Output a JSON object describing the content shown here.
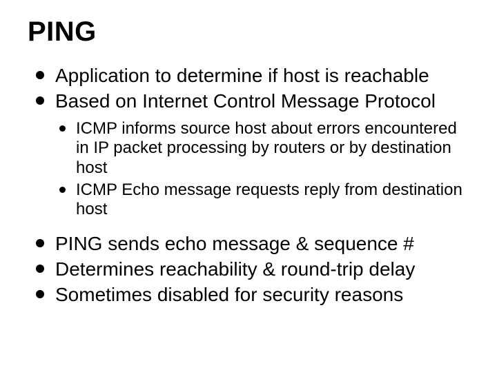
{
  "title": "PING",
  "bullets_top": [
    "Application to determine if host is reachable",
    "Based on Internet Control Message Protocol"
  ],
  "sub_bullets": [
    "ICMP informs source host about errors encountered in IP packet processing by routers or by destination host",
    "ICMP Echo message requests reply from destination host"
  ],
  "bullets_bottom": [
    "PING sends echo message & sequence #",
    "Determines reachability & round-trip delay",
    "Sometimes disabled for security reasons"
  ]
}
